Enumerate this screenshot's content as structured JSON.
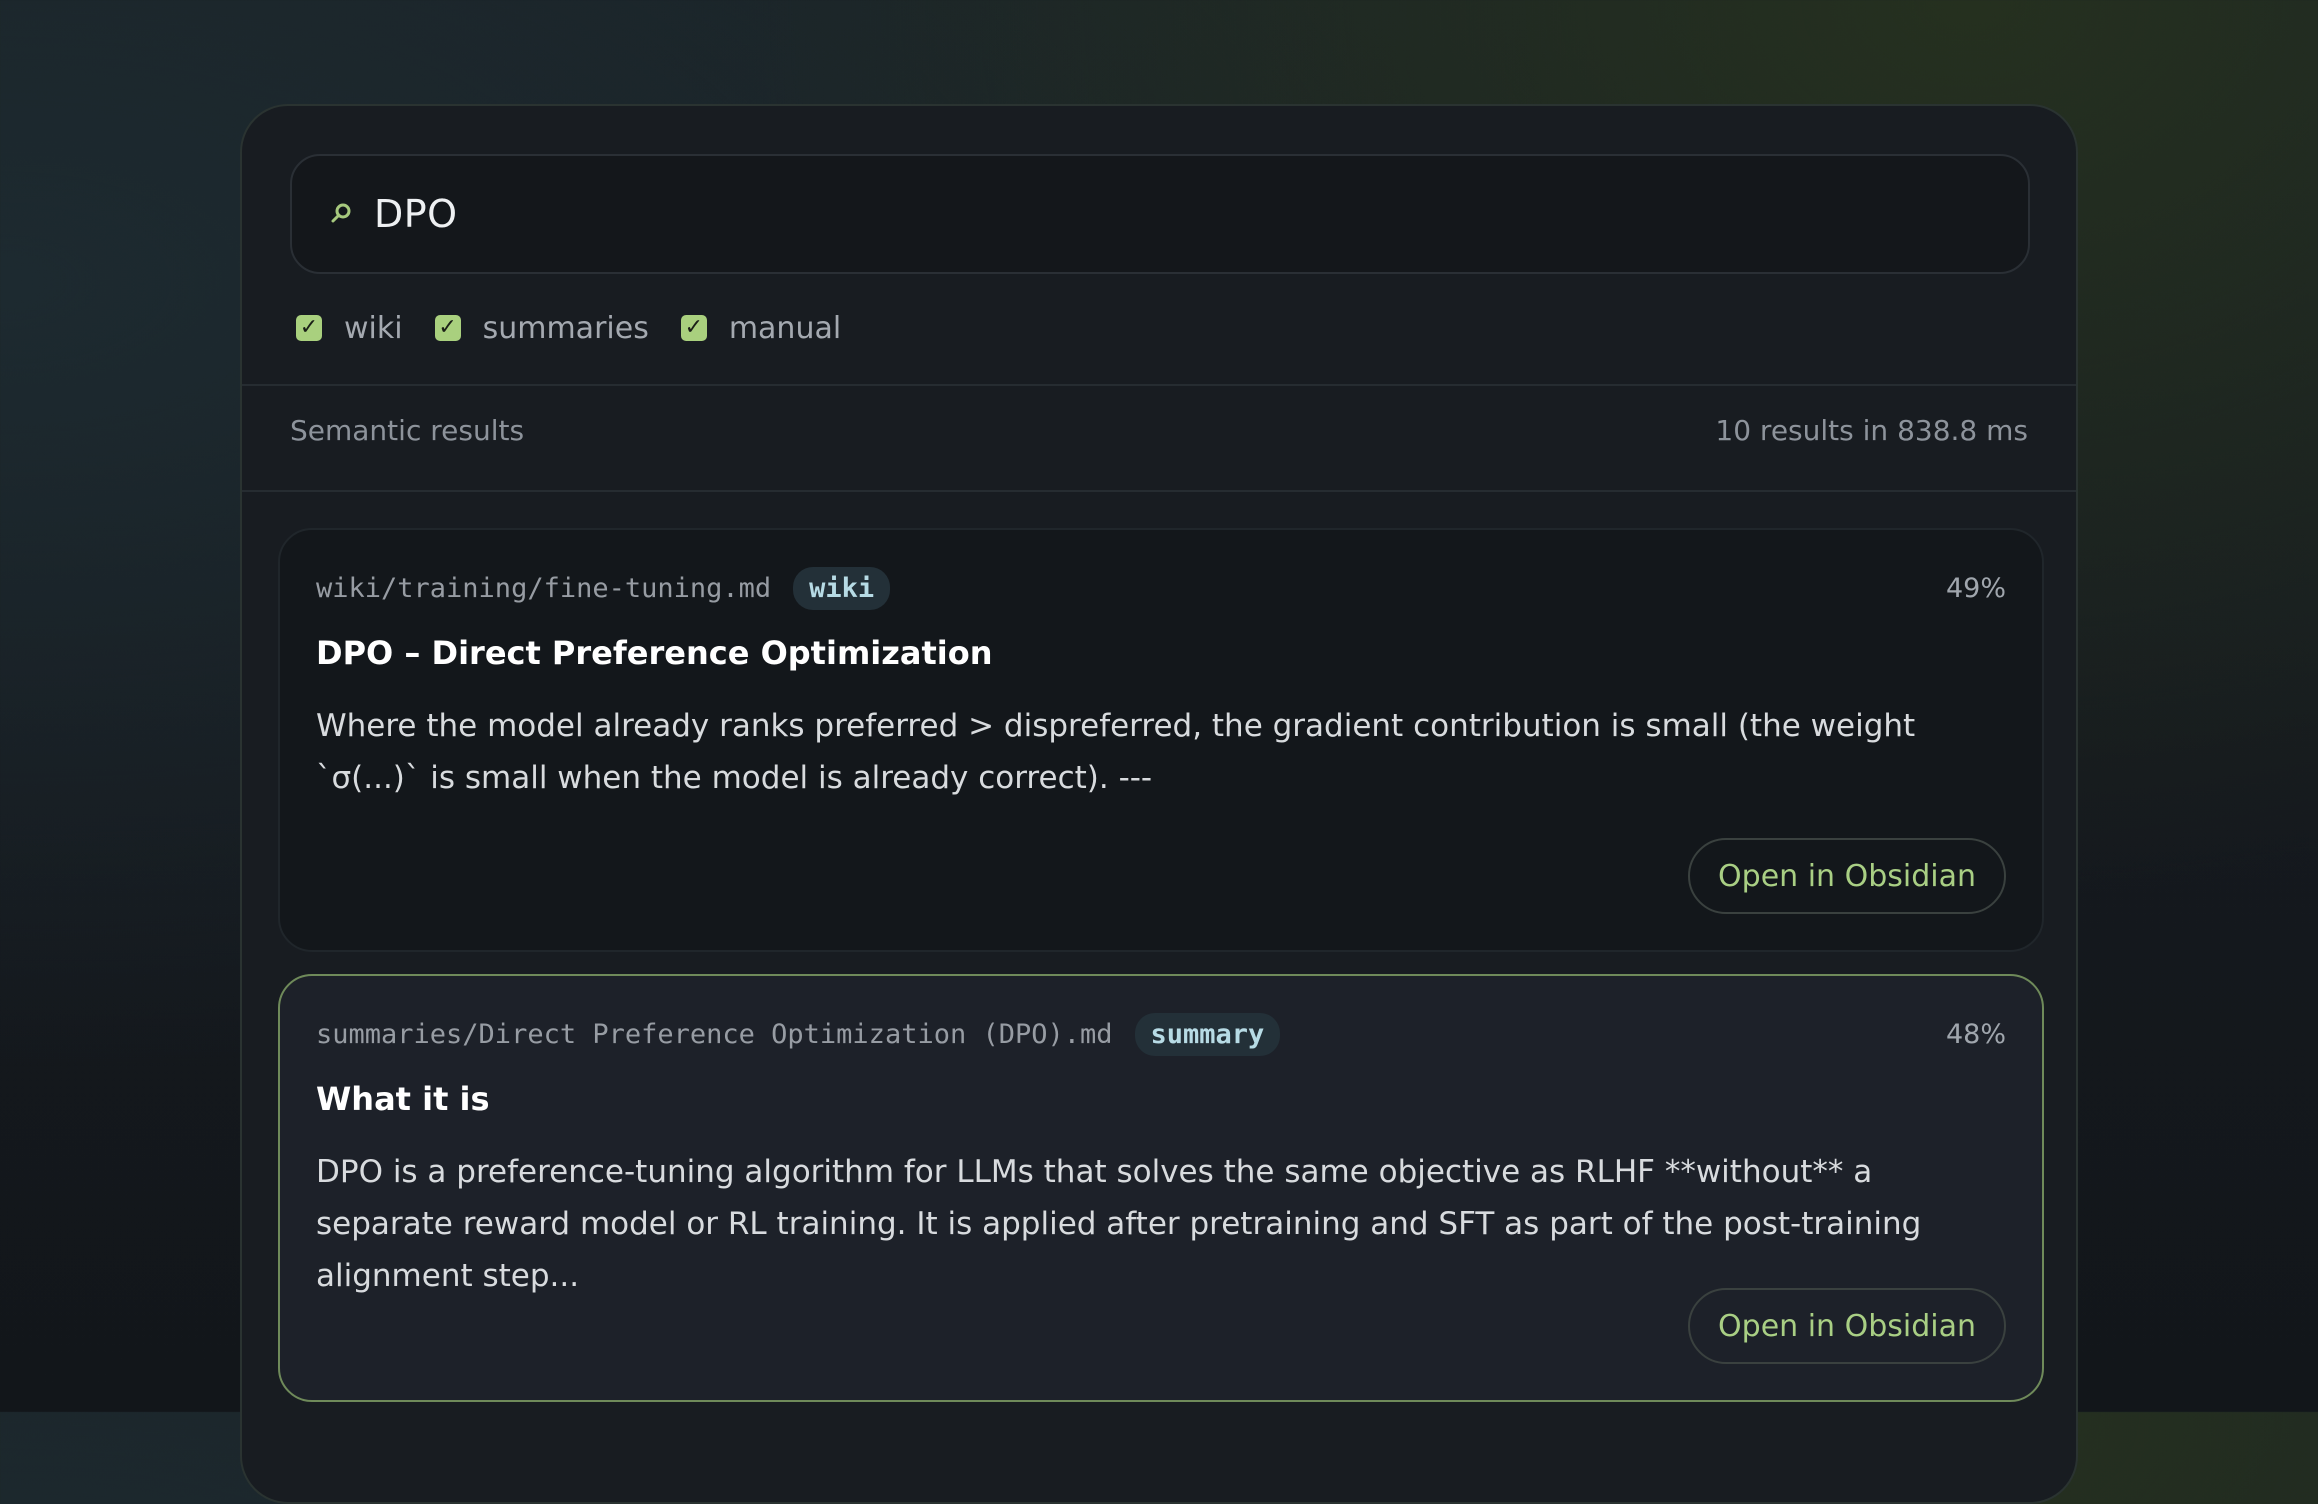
{
  "search": {
    "query": "DPO",
    "icon": "search-icon"
  },
  "filters": [
    {
      "label": "wiki",
      "checked": true
    },
    {
      "label": "summaries",
      "checked": true
    },
    {
      "label": "manual",
      "checked": true
    }
  ],
  "results_header": {
    "mode": "Semantic results",
    "summary": "10 results in 838.8 ms"
  },
  "results": [
    {
      "path": "wiki/training/fine-tuning.md",
      "tag": "wiki",
      "score": "49%",
      "title": "DPO – Direct Preference Optimization",
      "snippet": "Where the model already ranks preferred > dispreferred, the gradient contribution is small (the weight `σ(...)` is small when the model is already correct). ---",
      "action": "Open in Obsidian"
    },
    {
      "path": "summaries/Direct Preference Optimization (DPO).md",
      "tag": "summary",
      "score": "48%",
      "title": "What it is",
      "snippet": "DPO is a preference-tuning algorithm for LLMs that solves the same objective as RLHF **without** a separate reward model or RL training. It is applied after pretraining and SFT as part of the post-training alignment step...",
      "action": "Open in Obsidian"
    }
  ],
  "colors": {
    "accent": "#a9d07e",
    "selected_border": "#6f8a5a",
    "tag_bg": "#233038"
  }
}
